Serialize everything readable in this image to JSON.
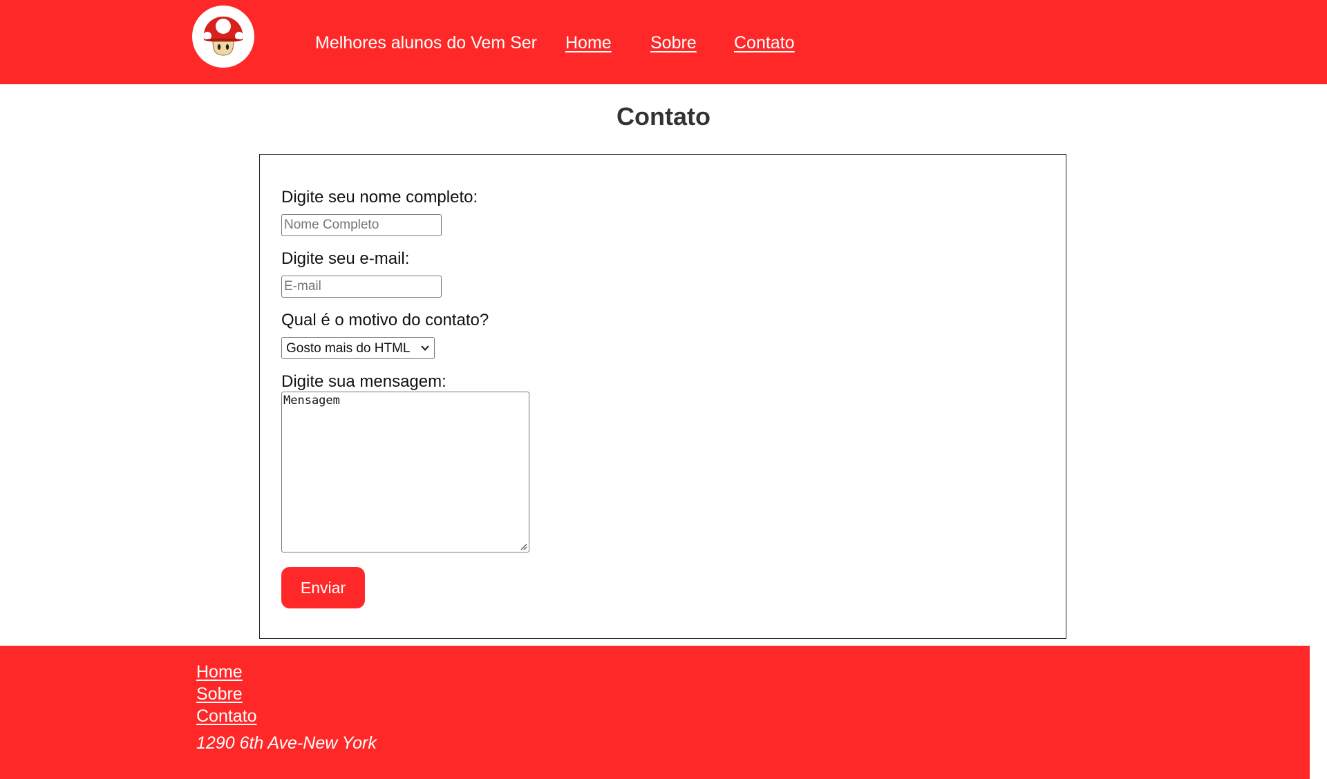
{
  "header": {
    "logo_icon": "mushroom-icon",
    "site_title": "Melhores alunos do Vem Ser",
    "nav": [
      {
        "label": "Home"
      },
      {
        "label": "Sobre"
      },
      {
        "label": "Contato"
      }
    ],
    "background_color": "#ff2828"
  },
  "main": {
    "title": "Contato",
    "form": {
      "name": {
        "label": "Digite seu nome completo:",
        "placeholder": "Nome Completo",
        "value": ""
      },
      "email": {
        "label": "Digite seu e-mail:",
        "placeholder": "E-mail",
        "value": ""
      },
      "reason": {
        "label": "Qual é o motivo do contato?",
        "selected": "Gosto mais do HTML",
        "icon": "chevron-down-icon"
      },
      "message": {
        "label": "Digite sua mensagem:",
        "value": "Mensagem"
      },
      "submit_label": "Enviar"
    }
  },
  "footer": {
    "links": [
      {
        "label": "Home"
      },
      {
        "label": "Sobre"
      },
      {
        "label": "Contato"
      }
    ],
    "address": "1290 6th Ave-New York"
  }
}
